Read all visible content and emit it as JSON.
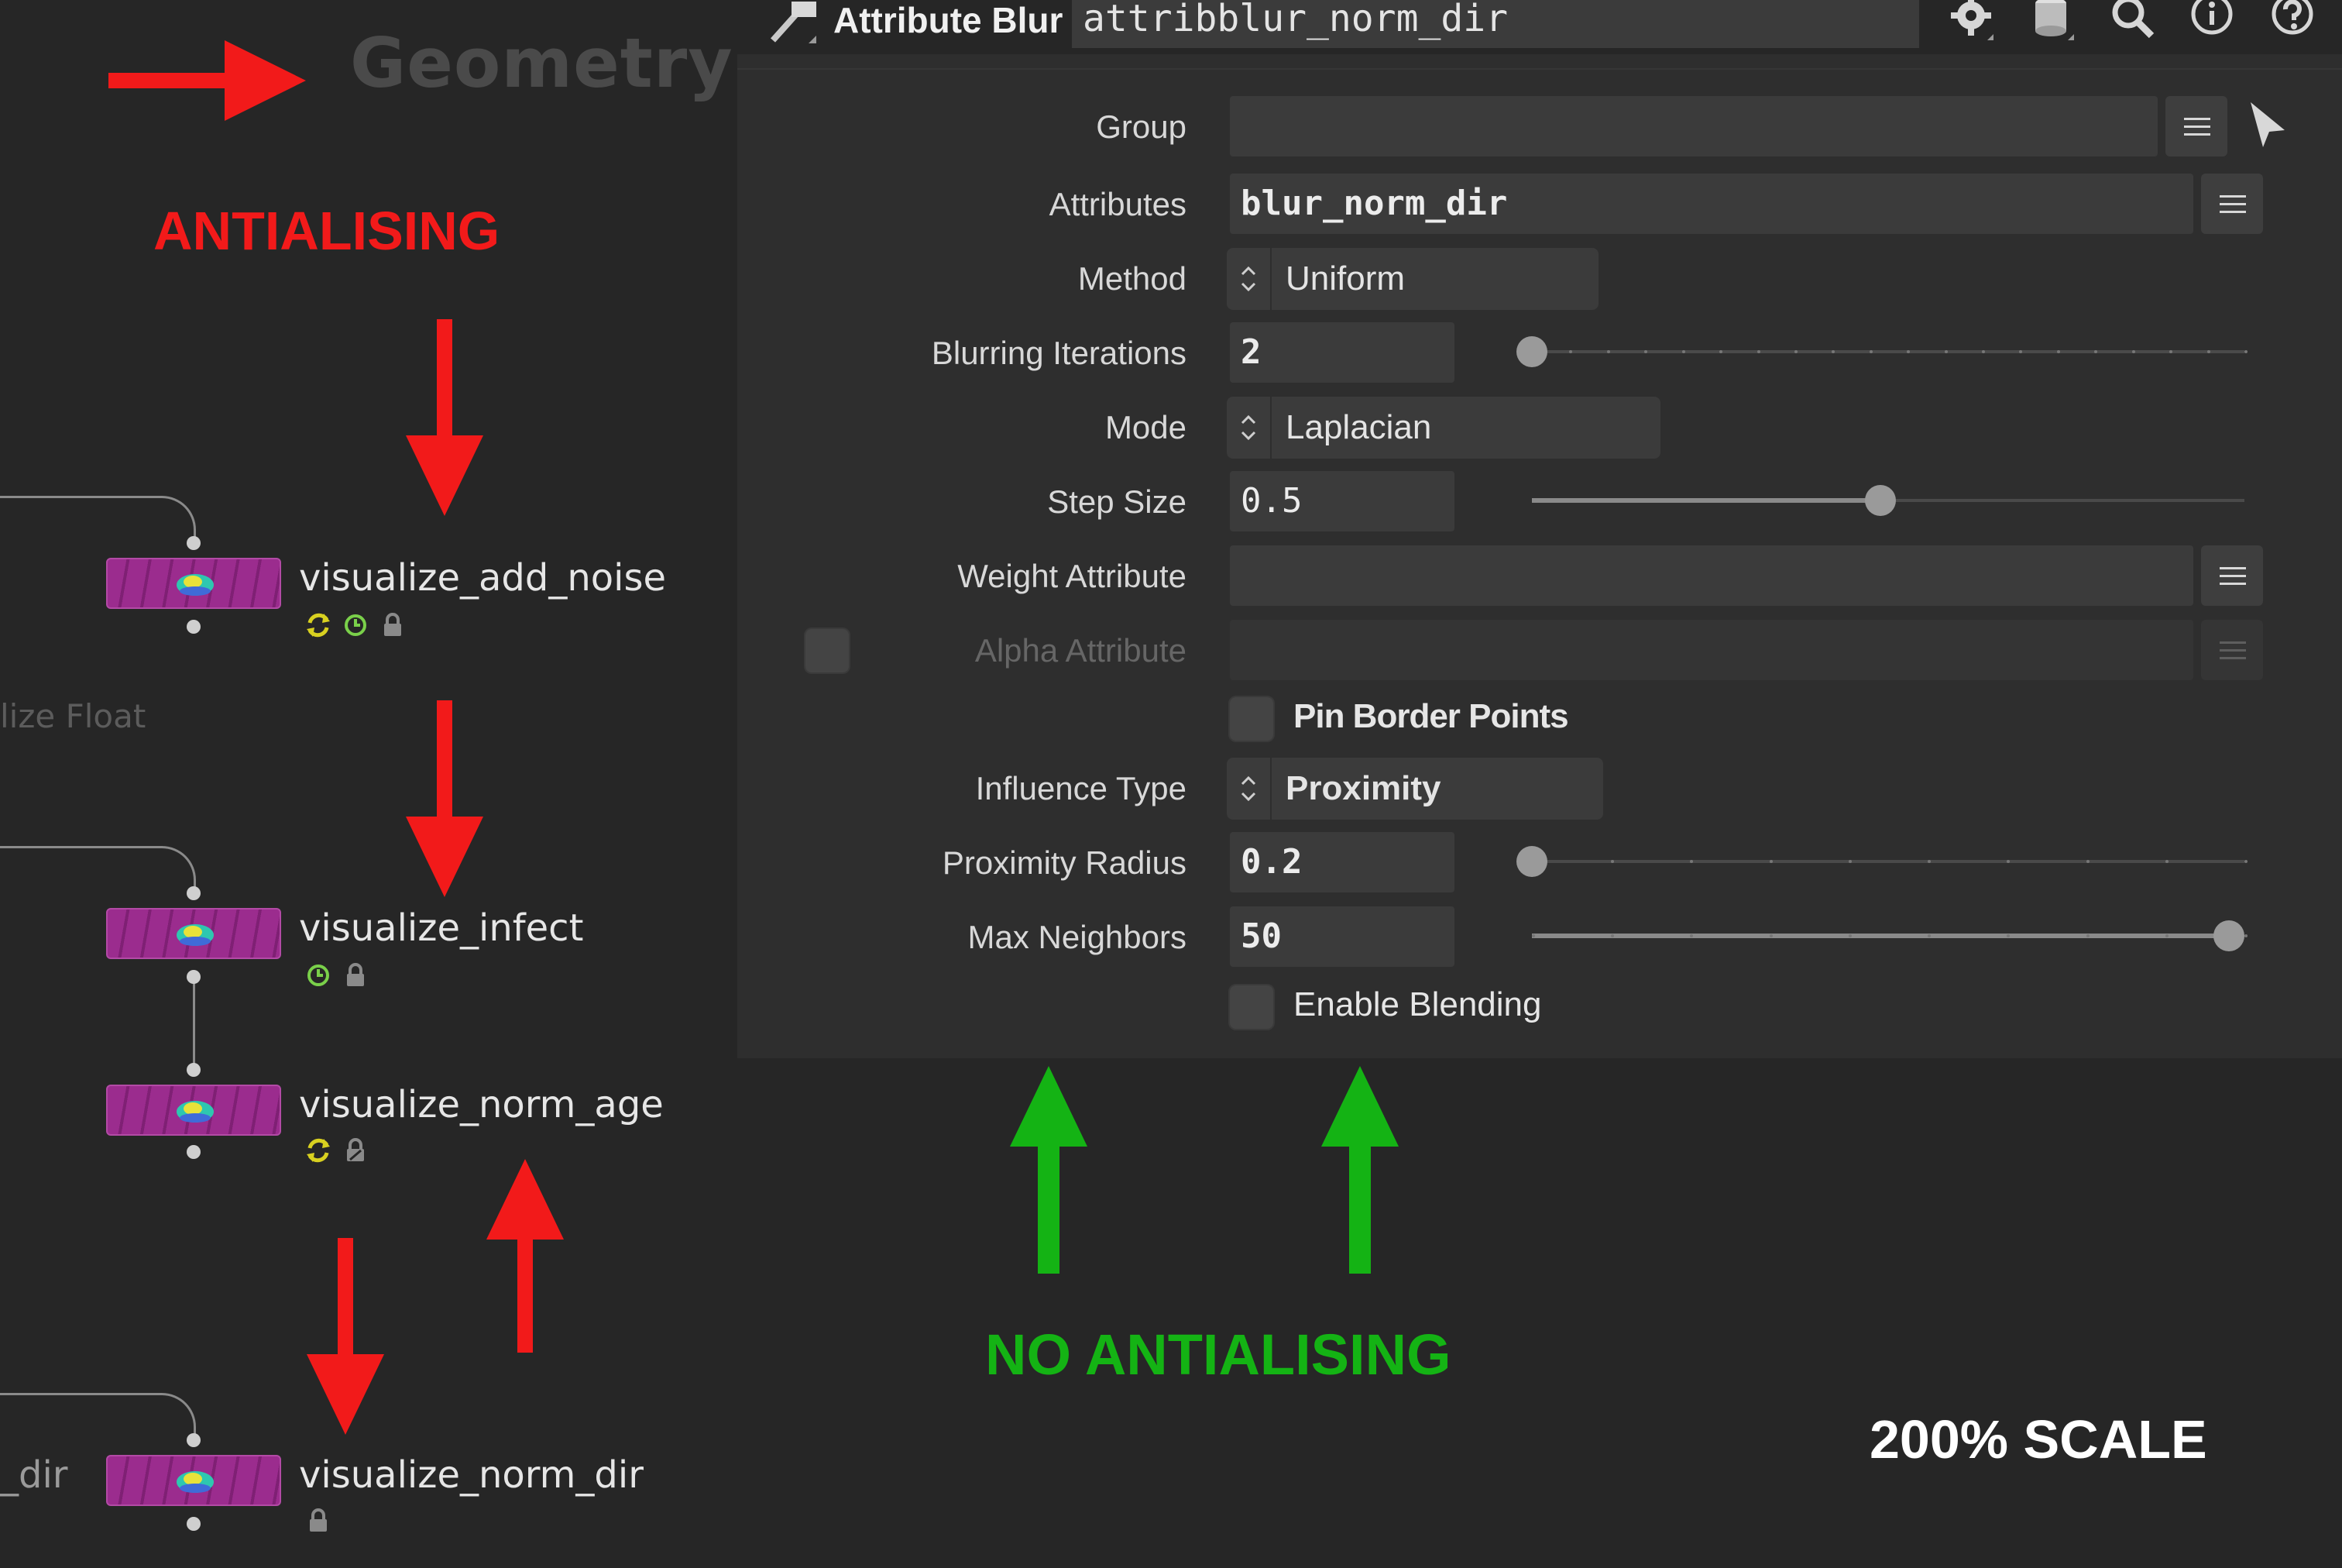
{
  "network": {
    "context_title": "Geometry",
    "ghost_labels": [
      "lize Float",
      "_dir"
    ],
    "nodes": [
      {
        "label": "visualize_add_noise"
      },
      {
        "label": "visualize_infect"
      },
      {
        "label": "visualize_norm_age"
      },
      {
        "label": "visualize_norm_dir"
      }
    ]
  },
  "annotations": {
    "antialiasing": "ANTIALISING",
    "no_antialiasing": "NO ANTIALISING",
    "scale": "200% SCALE",
    "colors": {
      "red": "#f21a1a",
      "green": "#14b314",
      "white": "#ffffff"
    }
  },
  "header": {
    "node_type": "Attribute Blur",
    "node_name": "attribblur_norm_dir",
    "icons": [
      "gear-icon",
      "cylinder-icon",
      "search-icon",
      "info-icon",
      "help-icon"
    ]
  },
  "params": {
    "group": {
      "label": "Group",
      "value": ""
    },
    "attributes": {
      "label": "Attributes",
      "value": "blur_norm_dir"
    },
    "method": {
      "label": "Method",
      "value": "Uniform"
    },
    "blurring_iterations": {
      "label": "Blurring Iterations",
      "value": "2",
      "slider": 0.0
    },
    "mode": {
      "label": "Mode",
      "value": "Laplacian"
    },
    "step_size": {
      "label": "Step Size",
      "value": "0.5",
      "slider": 0.5
    },
    "weight_attribute": {
      "label": "Weight Attribute",
      "value": ""
    },
    "alpha_attribute": {
      "label": "Alpha Attribute",
      "value": ""
    },
    "pin_border_points": {
      "label": "Pin Border Points",
      "checked": false
    },
    "influence_type": {
      "label": "Influence Type",
      "value": "Proximity"
    },
    "proximity_radius": {
      "label": "Proximity Radius",
      "value": "0.2",
      "slider": 0.0
    },
    "max_neighbors": {
      "label": "Max Neighbors",
      "value": "50",
      "slider": 1.0
    },
    "enable_blending": {
      "label": "Enable Blending",
      "checked": false
    }
  }
}
